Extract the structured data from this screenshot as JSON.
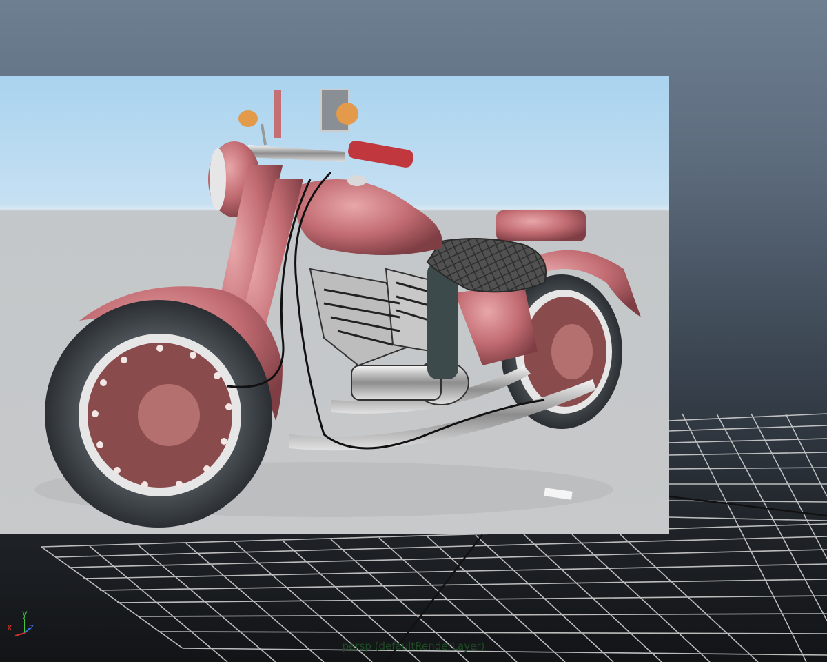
{
  "viewport": {
    "camera_label": "persp (defaultRenderLayer)",
    "axis_labels": {
      "x": "x",
      "y": "y",
      "z": "z"
    },
    "colors": {
      "axis_x": "#d0312d",
      "axis_y": "#3ec83e",
      "axis_z": "#3a6fe0",
      "grid": "#e8e8e8",
      "body_paint": "#c46f74",
      "chrome": "#d9d9d9",
      "seat": "#4a4a4a"
    }
  },
  "render_frame": {
    "subject": "motorcycle-render"
  }
}
